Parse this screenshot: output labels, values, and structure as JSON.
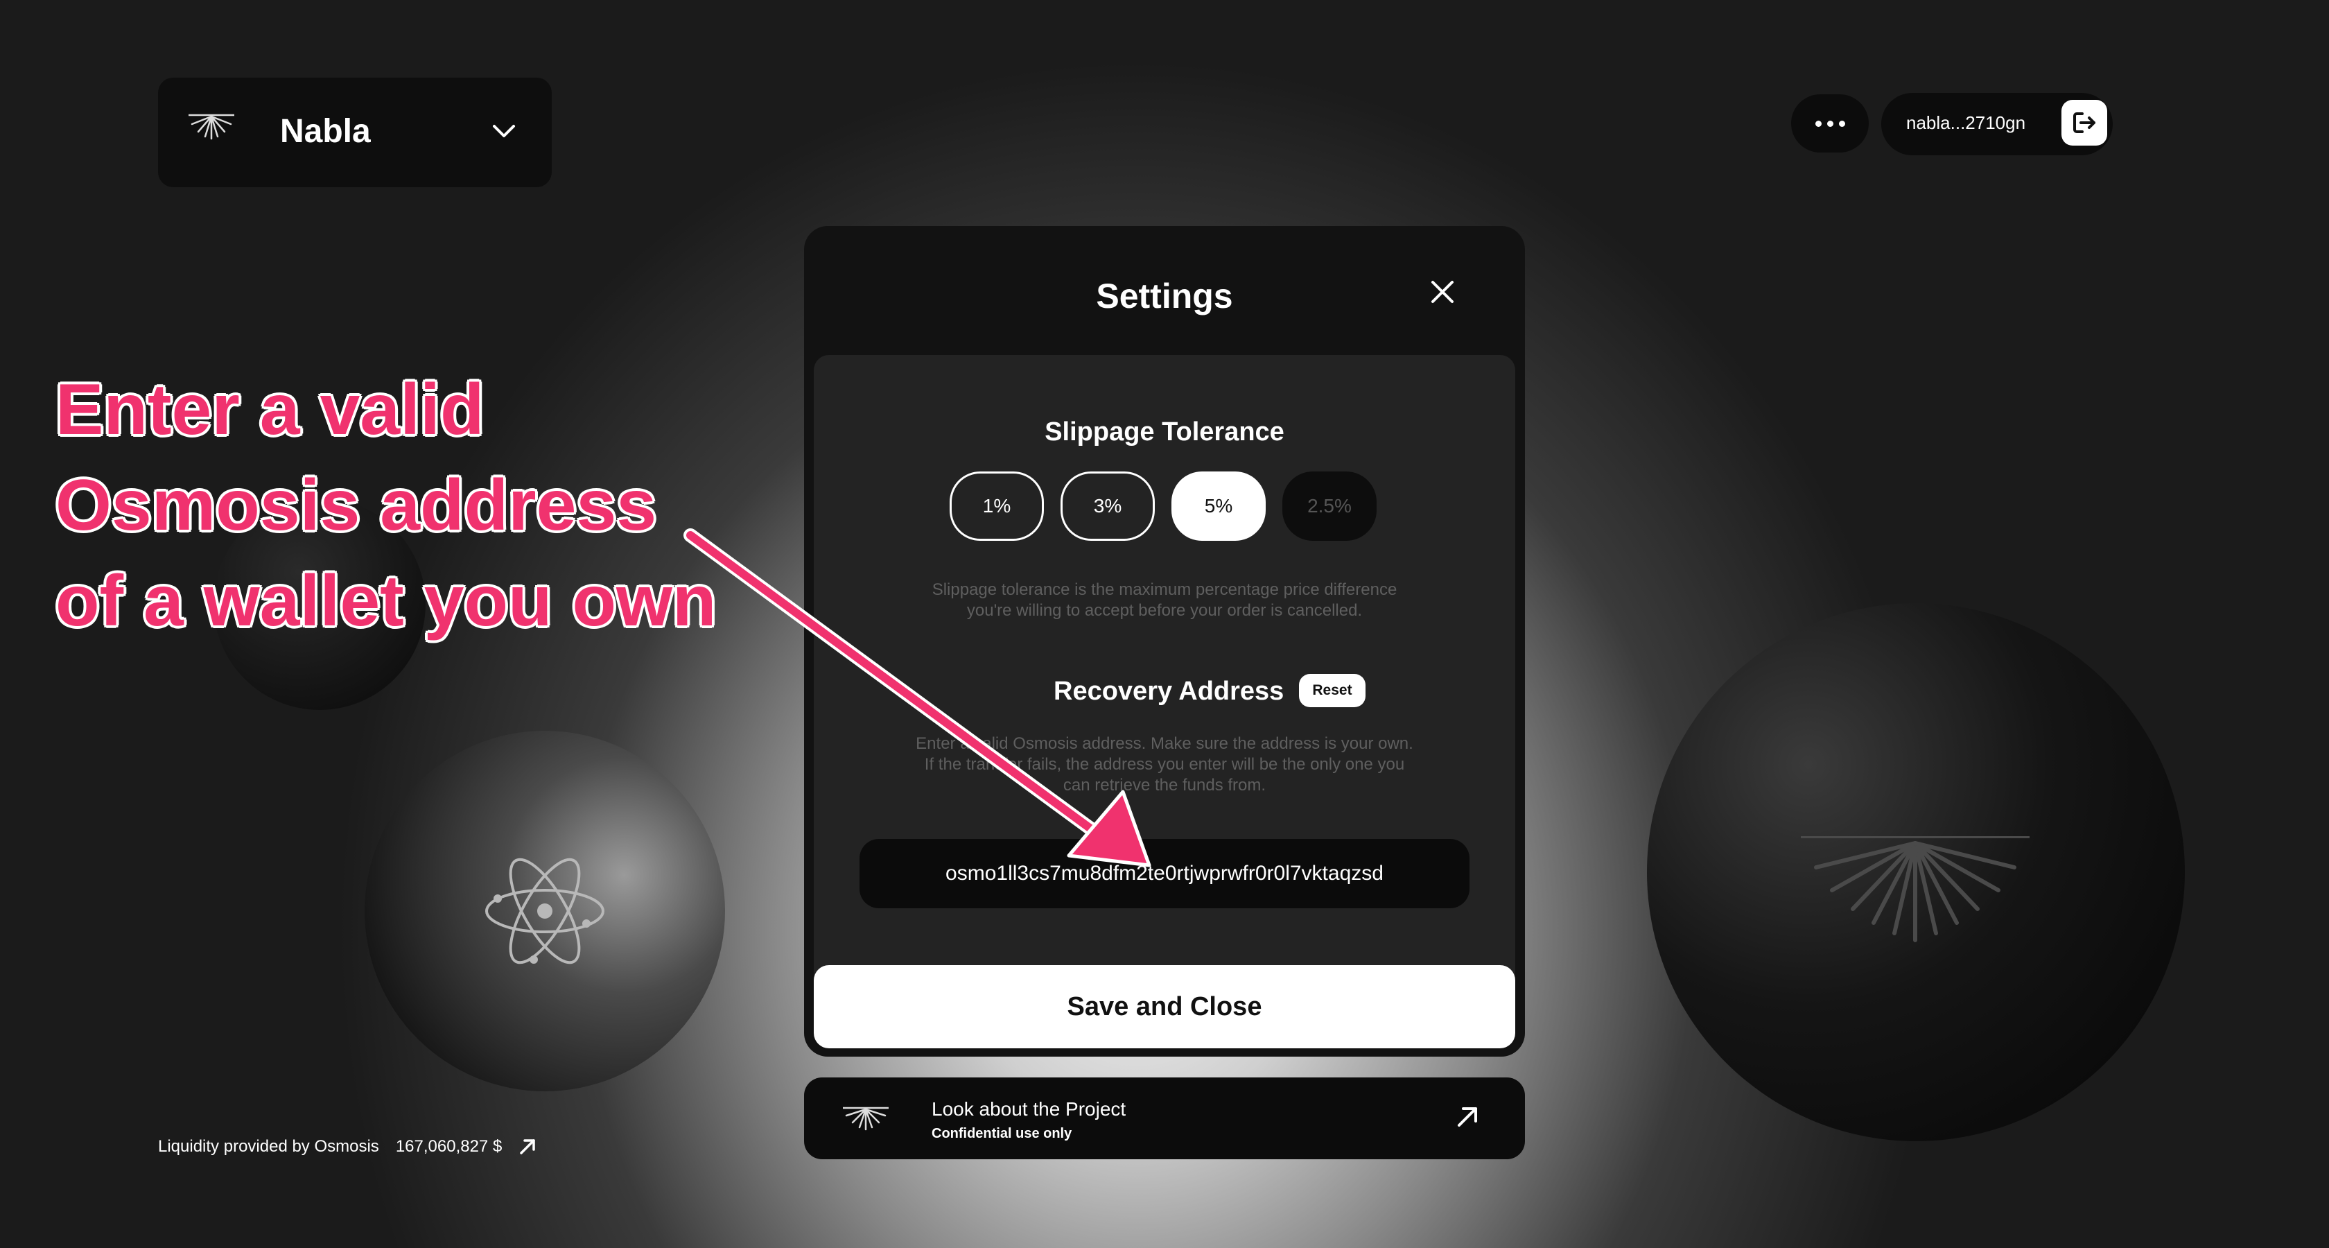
{
  "header": {
    "network_name": "Nabla",
    "wallet_address": "nabla...2710gn"
  },
  "settings": {
    "title": "Settings",
    "slippage": {
      "title": "Slippage Tolerance",
      "options": [
        "1%",
        "3%",
        "5%",
        "2.5%"
      ],
      "selected": "5%",
      "description_line1": "Slippage tolerance is the maximum percentage price difference",
      "description_line2": "you're willing to accept before your order is cancelled."
    },
    "recovery": {
      "title": "Recovery Address",
      "reset_label": "Reset",
      "description_line1": "Enter a valid Osmosis address. Make sure the address is your own.",
      "description_line2": "If the transfer fails, the address you enter will be the only one you",
      "description_line3": "can retrieve the funds from.",
      "address_value": "osmo1ll3cs7mu8dfm2te0rtjwprwfr0r0l7vktaqzsd"
    },
    "save_label": "Save and Close"
  },
  "project": {
    "title": "Look about the Project",
    "subtitle": "Confidential use only"
  },
  "footer": {
    "liquidity_label": "Liquidity provided by Osmosis",
    "liquidity_value": "167,060,827 $"
  },
  "annotation": {
    "line1": "Enter a valid",
    "line2": "Osmosis address",
    "line3": "of a wallet you own",
    "color": "#f0326e"
  }
}
